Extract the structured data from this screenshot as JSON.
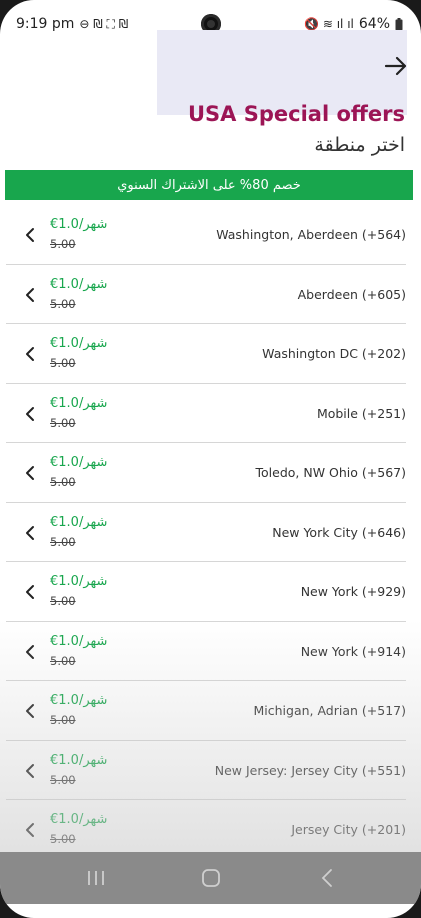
{
  "status": {
    "time": "9:19 pm",
    "left_icons": "⊖ ₪ ⛶ ₪",
    "right_icons": "🔇 ≋ ıl ıl",
    "battery": "64%"
  },
  "header": {
    "title": "USA Special offers",
    "subtitle": "اختر منطقة"
  },
  "banner": {
    "text": "خصم 80% على الاشتراك السنوي"
  },
  "list": [
    {
      "city": "Washington, Aberdeen  (+564)",
      "price": "€1.0/شهر",
      "old_price": "5.00"
    },
    {
      "city": "Aberdeen  (+605)",
      "price": "€1.0/شهر",
      "old_price": "5.00"
    },
    {
      "city": "Washington DC  (+202)",
      "price": "€1.0/شهر",
      "old_price": "5.00"
    },
    {
      "city": "Mobile  (+251)",
      "price": "€1.0/شهر",
      "old_price": "5.00"
    },
    {
      "city": "Toledo, NW Ohio  (+567)",
      "price": "€1.0/شهر",
      "old_price": "5.00"
    },
    {
      "city": "New York City  (+646)",
      "price": "€1.0/شهر",
      "old_price": "5.00"
    },
    {
      "city": "New York  (+929)",
      "price": "€1.0/شهر",
      "old_price": "5.00"
    },
    {
      "city": "New York  (+914)",
      "price": "€1.0/شهر",
      "old_price": "5.00"
    },
    {
      "city": "Michigan, Adrian  (+517)",
      "price": "€1.0/شهر",
      "old_price": "5.00"
    },
    {
      "city": "New Jersey: Jersey City  (+551)",
      "price": "€1.0/شهر",
      "old_price": "5.00"
    },
    {
      "city": "Jersey City  (+201)",
      "price": "€1.0/شهر",
      "old_price": "5.00"
    }
  ],
  "colors": {
    "title": "#9c1555",
    "banner": "#18a64d",
    "price": "#18a64d"
  },
  "icons": {
    "back": "arrow-right-icon",
    "row": "chevron-left-icon",
    "nav": [
      "recents-icon",
      "home-icon",
      "back-icon"
    ]
  }
}
